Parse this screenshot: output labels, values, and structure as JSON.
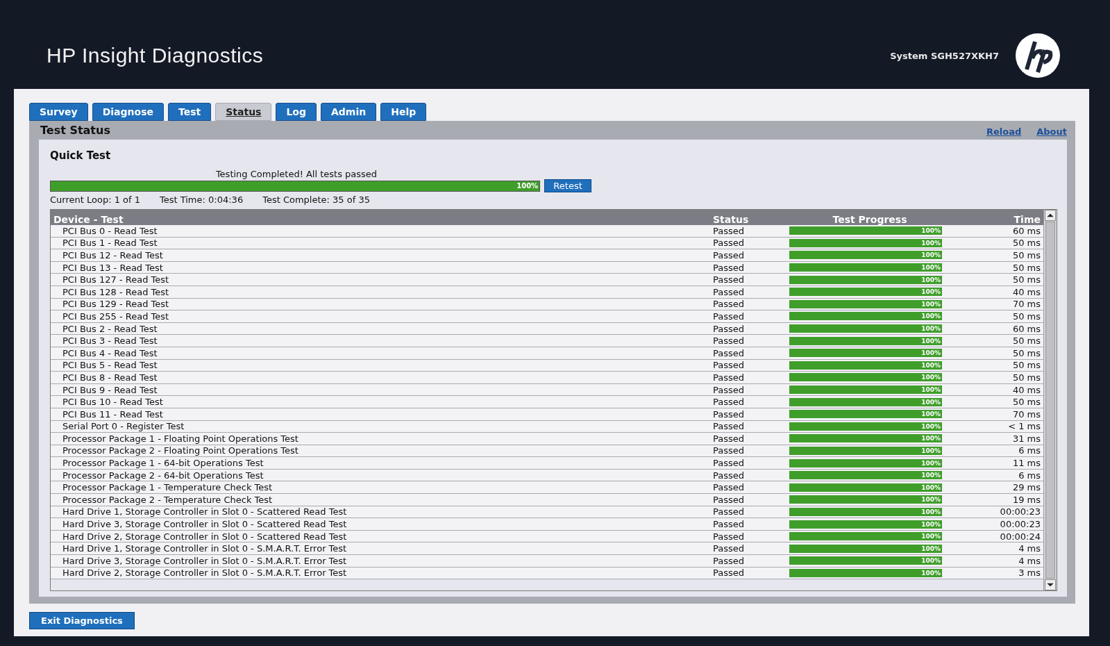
{
  "header": {
    "title": "HP Insight Diagnostics",
    "system": "System SGH527XKH7"
  },
  "tabs": [
    {
      "label": "Survey",
      "selected": false
    },
    {
      "label": "Diagnose",
      "selected": false
    },
    {
      "label": "Test",
      "selected": false
    },
    {
      "label": "Status",
      "selected": true
    },
    {
      "label": "Log",
      "selected": false
    },
    {
      "label": "Admin",
      "selected": false
    },
    {
      "label": "Help",
      "selected": false
    }
  ],
  "section": {
    "title": "Test Status",
    "links": [
      "Reload",
      "About"
    ]
  },
  "quick_test": {
    "title": "Quick Test",
    "message": "Testing Completed! All tests passed",
    "level": 1,
    "percent": "100%",
    "button": "Retest",
    "stats": [
      "Current Loop: 1 of 1",
      "Test Time: 0:04:36",
      "Test Complete: 35 of 35"
    ]
  },
  "table": {
    "columns": [
      "Device - Test",
      "Status",
      "Test Progress",
      "Time"
    ],
    "rows": [
      {
        "test": "PCI Bus 0 - Read Test",
        "status": "Passed",
        "level": 1,
        "percent": "100%",
        "time": "60 ms"
      },
      {
        "test": "PCI Bus 1 - Read Test",
        "status": "Passed",
        "level": 1,
        "percent": "100%",
        "time": "50 ms"
      },
      {
        "test": "PCI Bus 12 - Read Test",
        "status": "Passed",
        "level": 1,
        "percent": "100%",
        "time": "50 ms"
      },
      {
        "test": "PCI Bus 13 - Read Test",
        "status": "Passed",
        "level": 1,
        "percent": "100%",
        "time": "50 ms"
      },
      {
        "test": "PCI Bus 127 - Read Test",
        "status": "Passed",
        "level": 1,
        "percent": "100%",
        "time": "50 ms"
      },
      {
        "test": "PCI Bus 128 - Read Test",
        "status": "Passed",
        "level": 1,
        "percent": "100%",
        "time": "40 ms"
      },
      {
        "test": "PCI Bus 129 - Read Test",
        "status": "Passed",
        "level": 1,
        "percent": "100%",
        "time": "70 ms"
      },
      {
        "test": "PCI Bus 255 - Read Test",
        "status": "Passed",
        "level": 1,
        "percent": "100%",
        "time": "50 ms"
      },
      {
        "test": "PCI Bus 2 - Read Test",
        "status": "Passed",
        "level": 1,
        "percent": "100%",
        "time": "60 ms"
      },
      {
        "test": "PCI Bus 3 - Read Test",
        "status": "Passed",
        "level": 1,
        "percent": "100%",
        "time": "50 ms"
      },
      {
        "test": "PCI Bus 4 - Read Test",
        "status": "Passed",
        "level": 1,
        "percent": "100%",
        "time": "50 ms"
      },
      {
        "test": "PCI Bus 5 - Read Test",
        "status": "Passed",
        "level": 1,
        "percent": "100%",
        "time": "50 ms"
      },
      {
        "test": "PCI Bus 8 - Read Test",
        "status": "Passed",
        "level": 1,
        "percent": "100%",
        "time": "50 ms"
      },
      {
        "test": "PCI Bus 9 - Read Test",
        "status": "Passed",
        "level": 1,
        "percent": "100%",
        "time": "40 ms"
      },
      {
        "test": "PCI Bus 10 - Read Test",
        "status": "Passed",
        "level": 1,
        "percent": "100%",
        "time": "50 ms"
      },
      {
        "test": "PCI Bus 11 - Read Test",
        "status": "Passed",
        "level": 1,
        "percent": "100%",
        "time": "70 ms"
      },
      {
        "test": "Serial Port 0 - Register Test",
        "status": "Passed",
        "level": 1,
        "percent": "100%",
        "time": "< 1 ms"
      },
      {
        "test": "Processor Package 1 - Floating Point Operations Test",
        "status": "Passed",
        "level": 1,
        "percent": "100%",
        "time": "31 ms"
      },
      {
        "test": "Processor Package 2 - Floating Point Operations Test",
        "status": "Passed",
        "level": 1,
        "percent": "100%",
        "time": "6 ms"
      },
      {
        "test": "Processor Package 1 - 64-bit Operations Test",
        "status": "Passed",
        "level": 1,
        "percent": "100%",
        "time": "11 ms"
      },
      {
        "test": "Processor Package 2 - 64-bit Operations Test",
        "status": "Passed",
        "level": 1,
        "percent": "100%",
        "time": "6 ms"
      },
      {
        "test": "Processor Package 1 - Temperature Check Test",
        "status": "Passed",
        "level": 1,
        "percent": "100%",
        "time": "29 ms"
      },
      {
        "test": "Processor Package 2 - Temperature Check Test",
        "status": "Passed",
        "level": 1,
        "percent": "100%",
        "time": "19 ms"
      },
      {
        "test": "Hard Drive 1, Storage Controller in Slot 0 - Scattered Read Test",
        "status": "Passed",
        "level": 1,
        "percent": "100%",
        "time": "00:00:23"
      },
      {
        "test": "Hard Drive 3, Storage Controller in Slot 0 - Scattered Read Test",
        "status": "Passed",
        "level": 1,
        "percent": "100%",
        "time": "00:00:23"
      },
      {
        "test": "Hard Drive 2, Storage Controller in Slot 0 - Scattered Read Test",
        "status": "Passed",
        "level": 1,
        "percent": "100%",
        "time": "00:00:24"
      },
      {
        "test": "Hard Drive 1, Storage Controller in Slot 0 - S.M.A.R.T. Error Test",
        "status": "Passed",
        "level": 1,
        "percent": "100%",
        "time": "4 ms"
      },
      {
        "test": "Hard Drive 3, Storage Controller in Slot 0 - S.M.A.R.T. Error Test",
        "status": "Passed",
        "level": 1,
        "percent": "100%",
        "time": "4 ms"
      },
      {
        "test": "Hard Drive 2, Storage Controller in Slot 0 - S.M.A.R.T. Error Test",
        "status": "Passed",
        "level": 1,
        "percent": "100%",
        "time": "3 ms"
      }
    ]
  },
  "footer": {
    "button": "Exit Diagnostics"
  }
}
